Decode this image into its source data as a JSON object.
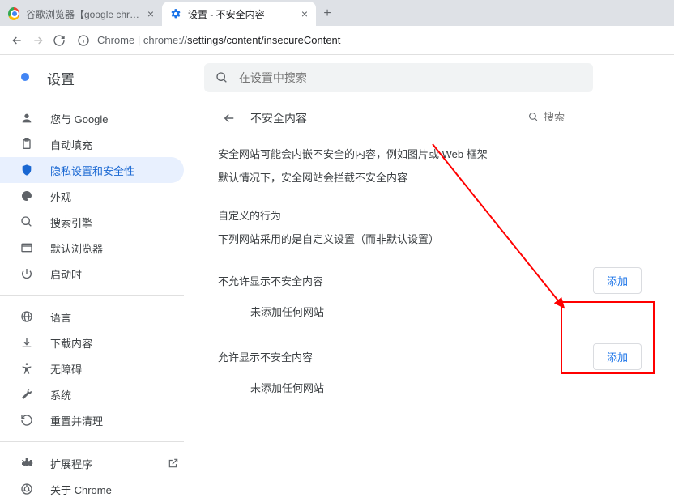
{
  "tabs": [
    {
      "title": "谷歌浏览器【google chrome】",
      "favicon": "chrome"
    },
    {
      "title": "设置 - 不安全内容",
      "favicon": "gear"
    }
  ],
  "newtab_glyph": "+",
  "omnibox": {
    "scheme_label": "Chrome",
    "separator": " | ",
    "url_prefix": "chrome://",
    "url_rest": "settings/content/insecureContent"
  },
  "settings": {
    "title": "设置",
    "search_placeholder": "在设置中搜索"
  },
  "sidebar": {
    "group1": [
      {
        "icon": "person",
        "label": "您与 Google"
      },
      {
        "icon": "clipboard",
        "label": "自动填充"
      },
      {
        "icon": "shield",
        "label": "隐私设置和安全性",
        "selected": true
      },
      {
        "icon": "palette",
        "label": "外观"
      },
      {
        "icon": "search",
        "label": "搜索引擎"
      },
      {
        "icon": "browser",
        "label": "默认浏览器"
      },
      {
        "icon": "power",
        "label": "启动时"
      }
    ],
    "group2": [
      {
        "icon": "globe",
        "label": "语言"
      },
      {
        "icon": "download",
        "label": "下载内容"
      },
      {
        "icon": "accessibility",
        "label": "无障碍"
      },
      {
        "icon": "wrench",
        "label": "系统"
      },
      {
        "icon": "restore",
        "label": "重置并清理"
      }
    ],
    "group3": [
      {
        "icon": "puzzle",
        "label": "扩展程序",
        "external": true
      },
      {
        "icon": "chrome",
        "label": "关于 Chrome"
      }
    ]
  },
  "panel": {
    "title": "不安全内容",
    "search_placeholder": "搜索",
    "desc1": "安全网站可能会内嵌不安全的内容，例如图片或 Web 框架",
    "desc2": "默认情况下，安全网站会拦截不安全内容",
    "custom_title": "自定义的行为",
    "custom_sub": "下列网站采用的是自定义设置（而非默认设置）",
    "block_title": "不允许显示不安全内容",
    "block_empty": "未添加任何网站",
    "allow_title": "允许显示不安全内容",
    "allow_empty": "未添加任何网站",
    "add_label": "添加"
  }
}
